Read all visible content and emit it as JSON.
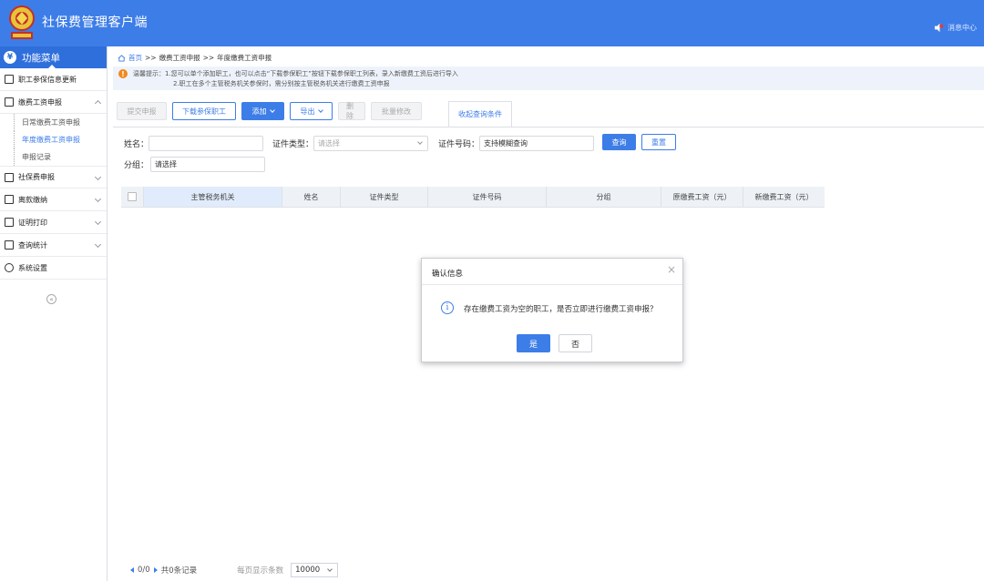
{
  "app": {
    "title": "社保费管理客户端",
    "message_center": "消息中心"
  },
  "sidebar": {
    "menu_title": "功能菜单",
    "items": [
      {
        "label": "职工参保信息更新"
      },
      {
        "label": "缴费工资申报",
        "children": [
          "日常缴费工资申报",
          "年度缴费工资申报",
          "申报记录"
        ]
      },
      {
        "label": "社保费申报"
      },
      {
        "label": "离款缴纳"
      },
      {
        "label": "证明打印"
      },
      {
        "label": "查询统计"
      },
      {
        "label": "系统设置"
      }
    ]
  },
  "breadcrumb": {
    "home": "首页",
    "sep1": ">>",
    "level1": "缴费工资申报",
    "sep2": ">>",
    "level2": "年度缴费工资申报"
  },
  "tip": {
    "line1": "温馨提示：1.您可以单个添加职工，也可以点击“下载参保职工”按钮下载参保职工列表，录入新缴费工资后进行导入",
    "line2": "2.职工在多个主管税务机关参保时，需分别按主管税务机关进行缴费工资申报"
  },
  "toolbar": {
    "submit": "提交申报",
    "download": "下载参保职工",
    "add": "添加",
    "export": "导出",
    "delete": "删除",
    "batch_edit": "批量修改",
    "collapse": "收起查询条件"
  },
  "form": {
    "name_label": "姓名：",
    "id_type_label": "证件类型：",
    "id_type_placeholder": "请选择",
    "id_no_label": "证件号码：",
    "id_no_placeholder": "支持模糊查询",
    "search": "查询",
    "reset": "重置",
    "group_label": "分组：",
    "group_placeholder": "请选择"
  },
  "table": {
    "columns": [
      "主管税务机关",
      "姓名",
      "证件类型",
      "证件号码",
      "分组",
      "原缴费工资（元）",
      "新缴费工资（元）"
    ]
  },
  "pager": {
    "summary": "0/0",
    "total": "共0条记录",
    "per_page_label": "每页显示条数",
    "per_page": "10000"
  },
  "dialog": {
    "title": "确认信息",
    "close": "×",
    "message": "存在缴费工资为空的职工，是否立即进行缴费工资申报？",
    "yes": "是",
    "no": "否"
  },
  "colors": {
    "header": "#3d7de8",
    "accent": "#3d7de8",
    "warning": "#f08a1c"
  }
}
